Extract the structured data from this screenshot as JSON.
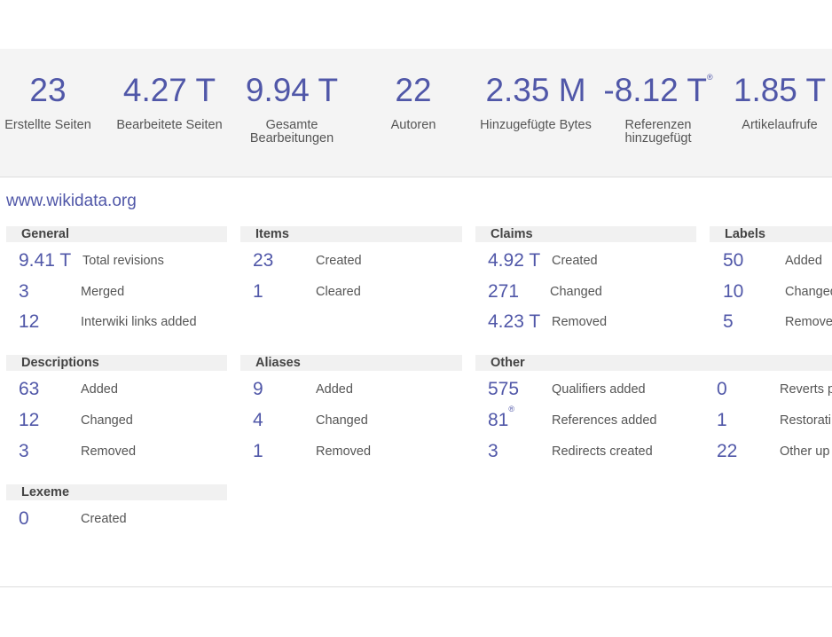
{
  "summary": {
    "stats": [
      {
        "value": "23",
        "label": "Erstellte Seiten"
      },
      {
        "value": "4.27 T",
        "label": "Bearbeitete Seiten"
      },
      {
        "value": "9.94 T",
        "label_line1": "Gesamte",
        "label_line2": "Bearbeitungen"
      },
      {
        "value": "22",
        "label": "Autoren"
      },
      {
        "value": "2.35 M",
        "label": "Hinzugefügte Bytes"
      },
      {
        "value": "-8.12 T",
        "label_line1": "Referenzen",
        "label_line2": "hinzugefügt",
        "marker": "®"
      },
      {
        "value": "1.85 T",
        "label": "Artikelaufrufe"
      }
    ]
  },
  "wiki": {
    "link": "www.wikidata.org",
    "sections": {
      "general": {
        "title": "General",
        "rows": [
          {
            "value": "9.41 T",
            "label": "Total revisions"
          },
          {
            "value": "3",
            "label": "Merged"
          },
          {
            "value": "12",
            "label": "Interwiki links added"
          }
        ]
      },
      "items": {
        "title": "Items",
        "rows": [
          {
            "value": "23",
            "label": "Created"
          },
          {
            "value": "1",
            "label": "Cleared"
          }
        ]
      },
      "claims": {
        "title": "Claims",
        "rows": [
          {
            "value": "4.92 T",
            "label": "Created"
          },
          {
            "value": "271",
            "label": "Changed"
          },
          {
            "value": "4.23 T",
            "label": "Removed"
          }
        ]
      },
      "labels": {
        "title": "Labels",
        "rows": [
          {
            "value": "50",
            "label": "Added"
          },
          {
            "value": "10",
            "label": "Changed"
          },
          {
            "value": "5",
            "label": "Removed"
          }
        ]
      },
      "descriptions": {
        "title": "Descriptions",
        "rows": [
          {
            "value": "63",
            "label": "Added"
          },
          {
            "value": "12",
            "label": "Changed"
          },
          {
            "value": "3",
            "label": "Removed"
          }
        ]
      },
      "aliases": {
        "title": "Aliases",
        "rows": [
          {
            "value": "9",
            "label": "Added"
          },
          {
            "value": "4",
            "label": "Changed"
          },
          {
            "value": "1",
            "label": "Removed"
          }
        ]
      },
      "other": {
        "title": "Other",
        "rows": [
          {
            "value": "575",
            "label": "Qualifiers added"
          },
          {
            "value": "81",
            "label": "References added",
            "marker": "®"
          },
          {
            "value": "3",
            "label": "Redirects created"
          }
        ],
        "rows_right": [
          {
            "value": "0",
            "label": "Reverts p"
          },
          {
            "value": "1",
            "label": "Restorati"
          },
          {
            "value": "22",
            "label": "Other up"
          }
        ]
      },
      "lexeme": {
        "title": "Lexeme",
        "rows": [
          {
            "value": "0",
            "label": "Created"
          }
        ]
      }
    }
  }
}
